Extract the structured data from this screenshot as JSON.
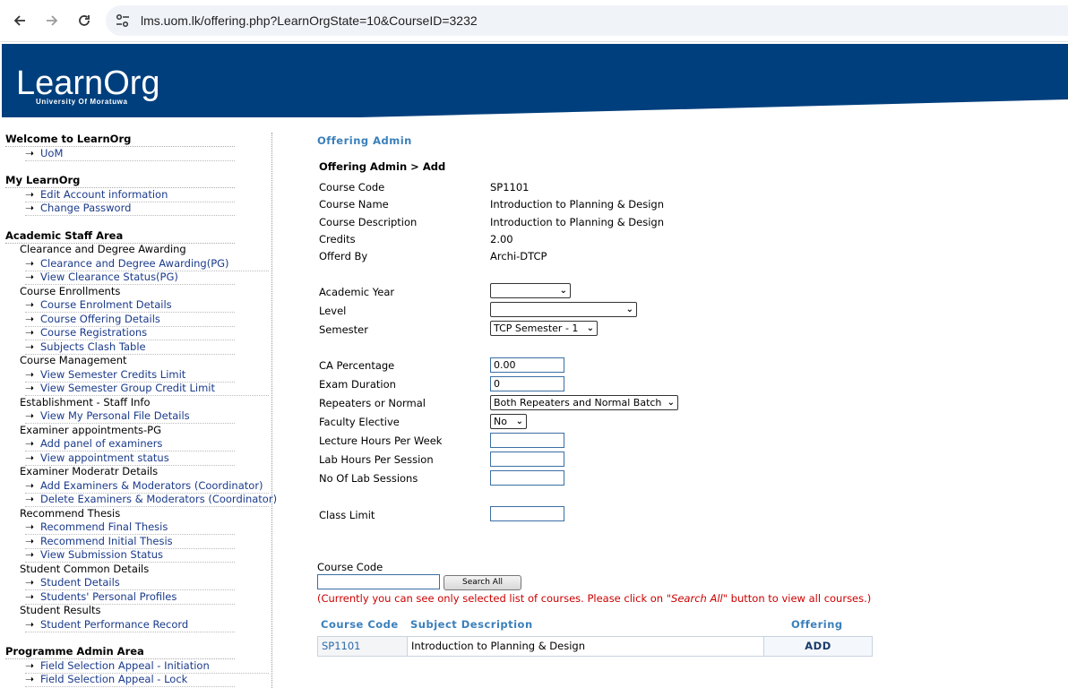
{
  "browser": {
    "url": "lms.uom.lk/offering.php?LearnOrgState=10&CourseID=3232",
    "back_icon": "arrow-left-icon",
    "forward_icon": "arrow-right-icon",
    "reload_icon": "reload-icon",
    "site_info_icon": "tune-icon"
  },
  "header": {
    "logo": "LearnOrg",
    "logo_sub": "University Of Moratuwa",
    "banner_color": "#003f7d"
  },
  "sidebar": {
    "welcome": {
      "title": "Welcome to LearnOrg",
      "links": [
        "UoM"
      ]
    },
    "my": {
      "title": "My LearnOrg",
      "links": [
        "Edit Account information",
        "Change Password"
      ]
    },
    "staff": {
      "title": "Academic Staff Area",
      "groups": [
        {
          "name": "Clearance and Degree Awarding",
          "links": [
            "Clearance and Degree Awarding(PG)",
            "View Clearance Status(PG)"
          ]
        },
        {
          "name": "Course Enrollments",
          "links": [
            "Course Enrolment Details",
            "Course Offering Details",
            "Course Registrations",
            "Subjects Clash Table"
          ]
        },
        {
          "name": "Course Management",
          "links": [
            "View Semester Credits Limit",
            "View Semester Group Credit Limit"
          ]
        },
        {
          "name": "Establishment - Staff Info",
          "links": [
            "View My Personal File Details"
          ]
        },
        {
          "name": "Examiner appointments-PG",
          "links": [
            "Add panel of examiners",
            "View appointment status"
          ]
        },
        {
          "name": "Examiner Moderatr Details",
          "links": [
            "Add Examiners & Moderators (Coordinator)",
            "Delete Examiners & Moderators (Coordinator)"
          ]
        },
        {
          "name": "Recommend Thesis",
          "links": [
            "Recommend Final Thesis",
            "Recommend Initial Thesis",
            "View Submission Status"
          ]
        },
        {
          "name": "Student Common Details",
          "links": [
            "Student Details",
            "Students' Personal Profiles"
          ]
        },
        {
          "name": "Student Results",
          "links": [
            "Student Performance Record"
          ]
        }
      ]
    },
    "prog": {
      "title": "Programme Admin Area",
      "links": [
        "Field Selection Appeal - Initiation",
        "Field Selection Appeal - Lock"
      ]
    }
  },
  "main": {
    "heading": "Offering Admin",
    "breadcrumb": "Offering Admin > Add",
    "info": {
      "course_code_label": "Course Code",
      "course_code": "SP1101",
      "course_name_label": "Course Name",
      "course_name": "Introduction to Planning & Design",
      "course_desc_label": "Course Description",
      "course_desc": "Introduction to Planning & Design",
      "credits_label": "Credits",
      "credits": "2.00",
      "offered_by_label": "Offerd By",
      "offered_by": "Archi-DTCP"
    },
    "form": {
      "academic_year_label": "Academic Year",
      "academic_year": "",
      "level_label": "Level",
      "level": "",
      "semester_label": "Semester",
      "semester": "TCP Semester - 1",
      "ca_label": "CA Percentage",
      "ca": "0.00",
      "exam_label": "Exam Duration",
      "exam": "0",
      "repeaters_label": "Repeaters or Normal",
      "repeaters": "Both Repeaters and Normal Batch",
      "elective_label": "Faculty Elective",
      "elective": "No",
      "lecture_label": "Lecture Hours Per Week",
      "lecture": "",
      "lab_label": "Lab Hours Per Session",
      "lab": "",
      "lab_sessions_label": "No Of Lab Sessions",
      "lab_sessions": "",
      "class_limit_label": "Class Limit",
      "class_limit": ""
    },
    "search": {
      "label": "Course Code",
      "value": "",
      "button": "Search All",
      "note_pre": "(Currently you can see only selected list of courses. Please click on ",
      "note_em": "\"Search All\"",
      "note_post": " button to view all courses.)"
    },
    "table": {
      "headers": [
        "Course Code",
        "Subject Description",
        "Offering"
      ],
      "rows": [
        {
          "code": "SP1101",
          "desc": "Introduction to Planning & Design",
          "action": "ADD"
        }
      ]
    }
  }
}
